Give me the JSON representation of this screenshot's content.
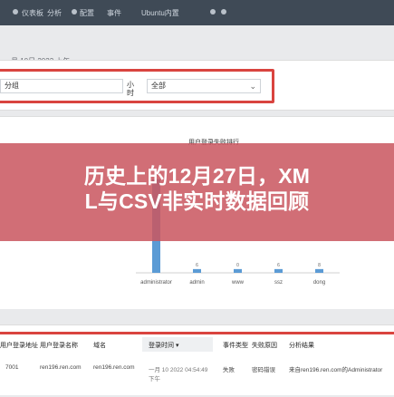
{
  "top_nav": {
    "items": [
      "仪表板",
      "分析",
      "配置",
      "事件"
    ],
    "right_text": "Ubuntu内置"
  },
  "date_strip": {
    "text": "一月 10日 2022 上午"
  },
  "filters": {
    "group_label": "分组",
    "scope_label": "小时",
    "scope_value": "全部"
  },
  "chart": {
    "title": "用户登录失败排行",
    "categories": [
      "administrator",
      "admin",
      "www",
      "ssz",
      "dong"
    ],
    "small_labels": [
      "0",
      "6",
      "0",
      "6",
      "8"
    ]
  },
  "chart_data": {
    "type": "bar",
    "title": "用户登录失败排行",
    "categories": [
      "administrator",
      "admin",
      "www",
      "ssz",
      "dong"
    ],
    "values": [
      25,
      1,
      1,
      1,
      1
    ],
    "ylim": [
      0,
      30
    ],
    "legend": "none"
  },
  "overlay": {
    "line1": "历史上的12月27日，XM",
    "line2": "L与CSV非实时数据回顾"
  },
  "table": {
    "headers": [
      "用户登录地址",
      "用户登录名称",
      "域名",
      "登录时间",
      "事件类型",
      "失败原因",
      "分析结果"
    ],
    "sort_header_index": 3,
    "rows": [
      [
        "7001",
        "ren196.ren.com",
        "ren196.ren.com",
        "一月 10 2022 04:54:49 下午",
        "失败",
        "密码错误",
        "来自ren196.ren.com的Administrator"
      ]
    ]
  },
  "colors": {
    "overlay": "#c95660",
    "highlight": "#d9443f",
    "nav": "#3f4a56",
    "bar": "#5b9bd5"
  },
  "icons": {
    "dropdown": "chevron-down-icon",
    "sort": "sort-down-icon"
  }
}
